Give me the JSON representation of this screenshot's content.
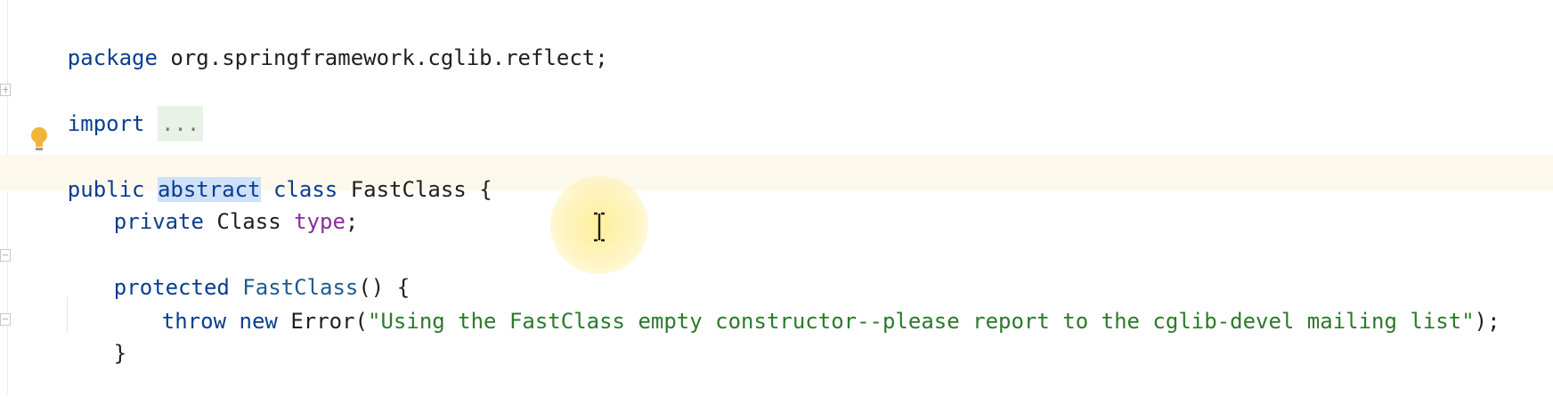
{
  "code": {
    "line1": {
      "kw": "package",
      "rest": " org.springframework.cglib.reflect;"
    },
    "line2": {
      "kw": "import",
      "folded": "..."
    },
    "line3": {
      "kw_public": "public",
      "kw_abstract": "abstract",
      "kw_class": "class",
      "name": "FastClass",
      "brace": "{"
    },
    "line4": {
      "kw": "private",
      "type": "Class",
      "field": "type",
      "semi": ";"
    },
    "line5": {
      "kw": "protected",
      "name": "FastClass",
      "sig": "() {"
    },
    "line6": {
      "kw_throw": "throw",
      "kw_new": "new",
      "ctor": "Error(",
      "str": "\"Using the FastClass empty constructor--please report to the cglib-devel mailing list\"",
      "end": ");"
    },
    "line7": {
      "brace": "}"
    }
  },
  "icons": {
    "bulb": "lightbulb-icon",
    "cursor": "text-cursor-icon"
  },
  "colors": {
    "keyword": "#0a3d8f",
    "string": "#2b7a2b",
    "field": "#8a2b9e",
    "selection": "#cfe0fb",
    "current_line": "#fdf8ec"
  }
}
